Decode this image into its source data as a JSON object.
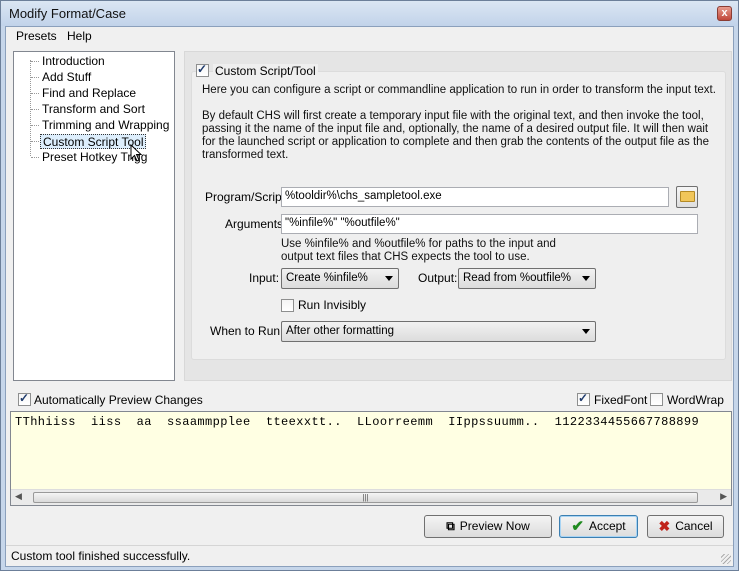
{
  "window": {
    "title": "Modify Format/Case",
    "close_label": "x"
  },
  "menu": {
    "items": [
      "Presets",
      "Help"
    ]
  },
  "tree": {
    "items": [
      {
        "label": "Introduction",
        "selected": false
      },
      {
        "label": "Add Stuff",
        "selected": false
      },
      {
        "label": "Find and Replace",
        "selected": false
      },
      {
        "label": "Transform and Sort",
        "selected": false
      },
      {
        "label": "Trimming and Wrapping",
        "selected": false
      },
      {
        "label": "Custom Script Tool",
        "selected": true
      },
      {
        "label": "Preset Hotkey Trigg",
        "selected": false
      }
    ]
  },
  "panel": {
    "enable_label": "Custom Script/Tool",
    "enable_checked": true,
    "intro": "Here you can configure a script or commandline application to run in order to transform the input text.",
    "description": "By default CHS will first create a temporary input file with the original text, and then invoke the tool, passing it the name of the input file and, optionally, the name of a desired output file.  It will then wait for the launched script or application to complete and then grab the contents of the output file as the transformed text.",
    "program_label": "Program/Script:",
    "program_value": "%tooldir%\\chs_sampletool.exe",
    "arguments_label": "Arguments:",
    "arguments_value": "\"%infile%\" \"%outfile%\"",
    "hint": "Use %infile% and %outfile% for paths to the input and output text files that CHS expects the tool to use.",
    "input_label": "Input:",
    "input_value": "Create %infile%",
    "output_label": "Output:",
    "output_value": "Read from %outfile%",
    "invisibly_label": "Run Invisibly",
    "invisibly_checked": false,
    "when_label": "When to Run:",
    "when_value": "After other formatting"
  },
  "options": {
    "auto_preview_label": "Automatically Preview Changes",
    "auto_preview_checked": true,
    "fixedfont_label": "FixedFont",
    "fixedfont_checked": true,
    "wordwrap_label": "WordWrap",
    "wordwrap_checked": false
  },
  "preview": {
    "text": "TThhiiss  iiss  aa  ssaammpplee  tteexxtt..  LLoorreemm  IIppssuumm..  1122334455667788899"
  },
  "buttons": {
    "preview_now": "Preview Now",
    "accept": "Accept",
    "cancel": "Cancel"
  },
  "status": {
    "text": "Custom tool finished successfully."
  }
}
